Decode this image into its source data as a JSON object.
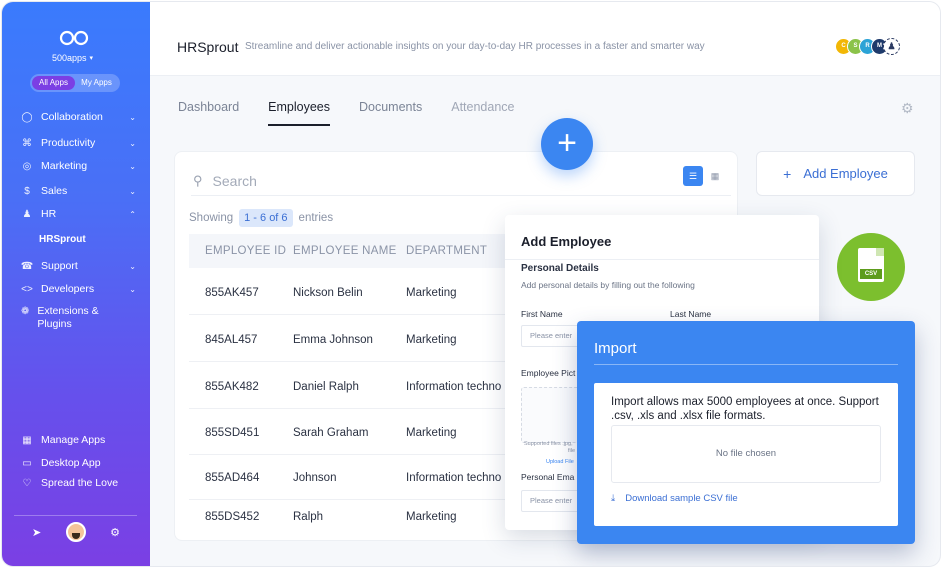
{
  "sidebar": {
    "brand": "500apps",
    "apps_toggle": [
      "All Apps",
      "My Apps"
    ],
    "items": [
      {
        "label": "Collaboration",
        "icon": "globe-icon"
      },
      {
        "label": "Productivity",
        "icon": "command-icon"
      },
      {
        "label": "Marketing",
        "icon": "target-icon"
      },
      {
        "label": "Sales",
        "icon": "dollar-icon"
      },
      {
        "label": "HR",
        "icon": "user-icon"
      },
      {
        "label": "Support",
        "icon": "headset-icon"
      },
      {
        "label": "Developers",
        "icon": "code-icon"
      },
      {
        "label": "Extensions & Plugins",
        "icon": "puzzle-icon"
      }
    ],
    "sub_item": "HRSprout",
    "bottom_items": [
      {
        "label": "Manage Apps",
        "icon": "grid-icon"
      },
      {
        "label": "Desktop App",
        "icon": "monitor-icon"
      },
      {
        "label": "Spread the Love",
        "icon": "heart-icon"
      }
    ]
  },
  "header": {
    "app_name": "HRSprout",
    "tagline": "Streamline and deliver actionable insights on your day-to-day HR processes in a faster and smarter way",
    "people": [
      {
        "initial": "C",
        "color": "#f2b705"
      },
      {
        "initial": "S",
        "color": "#8bc34a"
      },
      {
        "initial": "R",
        "color": "#2ba3d6"
      },
      {
        "initial": "M",
        "color": "#1e3a6b"
      }
    ]
  },
  "tabs": [
    "Dashboard",
    "Employees",
    "Documents",
    "Attendance"
  ],
  "table": {
    "search_placeholder": "Search",
    "showing_prefix": "Showing",
    "showing_range": "1 - 6 of 6",
    "showing_suffix": "entries",
    "columns": [
      "EMPLOYEE ID",
      "EMPLOYEE NAME",
      "DEPARTMENT"
    ],
    "rows": [
      [
        "855AK457",
        "Nickson Belin",
        "Marketing"
      ],
      [
        "845AL457",
        "Emma Johnson",
        "Marketing"
      ],
      [
        "855AK482",
        "Daniel Ralph",
        "Information techno"
      ],
      [
        "855SD451",
        "Sarah Graham",
        "Marketing"
      ],
      [
        "855AD464",
        "Johnson",
        "Information techno"
      ],
      [
        "855DS452",
        "Ralph",
        "Marketing"
      ]
    ]
  },
  "add_employee_button": "Add Employee",
  "csv_badge": "CSV",
  "add_employee_form": {
    "title": "Add Employee",
    "section": "Personal Details",
    "section_sub": "Add personal details by filling out the following",
    "first_name_label": "First Name",
    "last_name_label": "Last Name",
    "first_name_placeholder": "Please enter",
    "picture_label": "Employee Pict",
    "drop_line1": "D",
    "drop_line2": "here",
    "supported": "Supported files .jpg,",
    "supported2": "file",
    "upload": "Upload File",
    "email_label": "Personal Ema",
    "email_placeholder": "Please enter"
  },
  "import": {
    "title": "Import",
    "info": "Import allows max 5000 employees at once. Support .csv, .xls and .xlsx file formats.",
    "file_status": "No file chosen",
    "download": "Download sample CSV file"
  }
}
